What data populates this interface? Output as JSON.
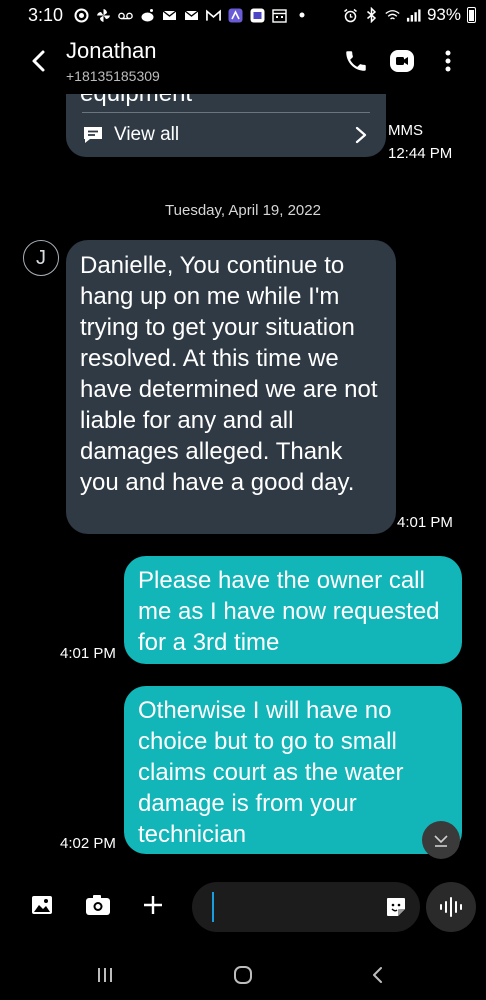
{
  "status_bar": {
    "time": "3:10",
    "battery": "93%",
    "left_icons": [
      "dnd-circle-icon",
      "pinwheel-icon",
      "voicemail-icon",
      "reddit-icon",
      "email-icon",
      "email-icon",
      "gmail-icon",
      "app-icon",
      "news-icon",
      "calendar-icon",
      "dot-icon"
    ],
    "right_icons": [
      "alarm-icon",
      "bluetooth-icon",
      "wifi-icon",
      "signal-icon",
      "battery-icon"
    ]
  },
  "header": {
    "contact_name": "Jonathan",
    "contact_number": "+18135185309",
    "icons": [
      "back-icon",
      "phone-icon",
      "video-call-icon",
      "more-icon"
    ]
  },
  "conversation": {
    "mms_card": {
      "partial_text": "equipment",
      "view_all_label": "View all",
      "type_label": "MMS",
      "time": "12:44 PM"
    },
    "date_separator": "Tuesday, April 19, 2022",
    "avatar_letter": "J",
    "messages": [
      {
        "direction": "incoming",
        "text": "Danielle, You continue to hang up on me while I'm trying to get your situation resolved. At this time we have determined we are not liable for any and all damages alleged. Thank you and have a good day.",
        "time": "4:01 PM"
      },
      {
        "direction": "outgoing",
        "text": "Please have the owner call me as I have now requested for a 3rd time",
        "time": "4:01 PM"
      },
      {
        "direction": "outgoing",
        "text": "Otherwise I will have no choice but to go to small claims court as the water damage is from your technician",
        "time": "4:02 PM"
      }
    ]
  },
  "input_bar": {
    "icons": [
      "gallery-icon",
      "camera-icon",
      "plus-icon",
      "sticker-icon",
      "voice-icon"
    ],
    "compose_value": ""
  },
  "nav_bar": {
    "icons": [
      "recents-icon",
      "home-icon",
      "back-nav-icon"
    ]
  },
  "colors": {
    "background": "#000000",
    "incoming_bubble": "#2f3a44",
    "outgoing_bubble": "#13b6b8",
    "cursor": "#1a9de0"
  }
}
